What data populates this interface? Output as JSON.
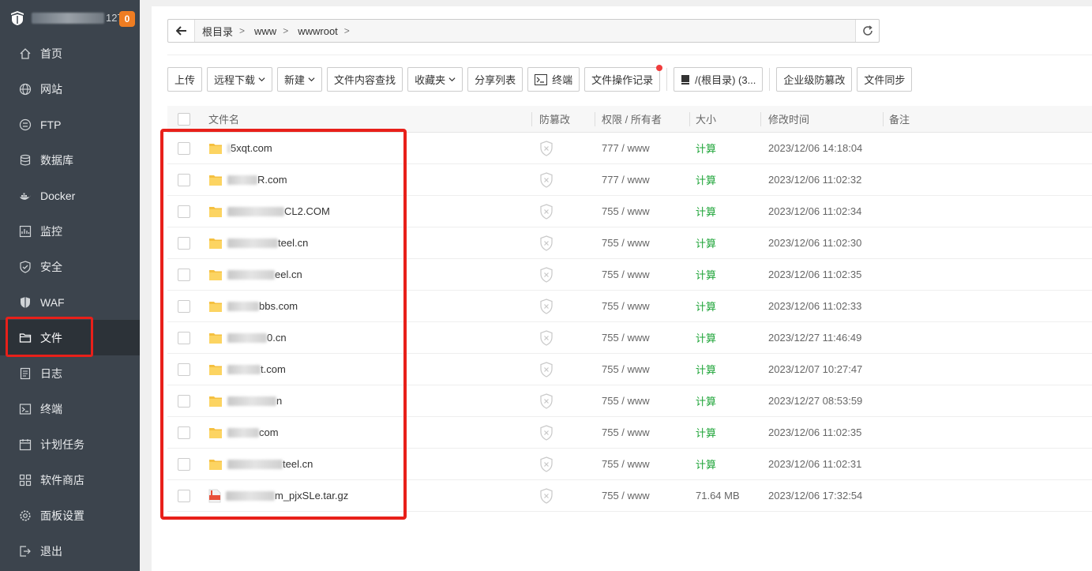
{
  "sidebar": {
    "server_ip_tail": "127",
    "badge_count": "0",
    "items": [
      {
        "label": "首页",
        "icon": "home-icon"
      },
      {
        "label": "网站",
        "icon": "globe-icon"
      },
      {
        "label": "FTP",
        "icon": "ftp-icon"
      },
      {
        "label": "数据库",
        "icon": "database-icon"
      },
      {
        "label": "Docker",
        "icon": "docker-icon"
      },
      {
        "label": "监控",
        "icon": "monitor-icon"
      },
      {
        "label": "安全",
        "icon": "shield-icon"
      },
      {
        "label": "WAF",
        "icon": "waf-shield-icon"
      },
      {
        "label": "文件",
        "icon": "folder-icon",
        "active": true
      },
      {
        "label": "日志",
        "icon": "log-icon"
      },
      {
        "label": "终端",
        "icon": "terminal-icon"
      },
      {
        "label": "计划任务",
        "icon": "calendar-icon"
      },
      {
        "label": "软件商店",
        "icon": "apps-icon"
      },
      {
        "label": "面板设置",
        "icon": "gear-icon"
      },
      {
        "label": "退出",
        "icon": "logout-icon"
      }
    ]
  },
  "pathbar": {
    "crumbs": [
      "根目录",
      "www",
      "wwwroot"
    ]
  },
  "toolbar": {
    "upload": "上传",
    "remote_download": "远程下载",
    "new": "新建",
    "content_search": "文件内容查找",
    "favorites": "收藏夹",
    "share_list": "分享列表",
    "terminal": "终端",
    "operation_log": "文件操作记录",
    "disk": "/(根目录) (3...",
    "enterprise_tamper": "企业级防篡改",
    "file_sync": "文件同步"
  },
  "table": {
    "headers": {
      "name": "文件名",
      "protect": "防篡改",
      "perm": "权限 / 所有者",
      "size": "大小",
      "mtime": "修改时间",
      "note": "备注"
    },
    "rows": [
      {
        "type": "folder",
        "name_visible": "5xqt.com",
        "perm": "777 / www",
        "size": "计算",
        "mtime": "2023/12/06 14:18:04"
      },
      {
        "type": "folder",
        "name_visible": "R.com",
        "perm": "777 / www",
        "size": "计算",
        "mtime": "2023/12/06 11:02:32"
      },
      {
        "type": "folder",
        "name_visible": "CL2.COM",
        "perm": "755 / www",
        "size": "计算",
        "mtime": "2023/12/06 11:02:34"
      },
      {
        "type": "folder",
        "name_visible": "teel.cn",
        "perm": "755 / www",
        "size": "计算",
        "mtime": "2023/12/06 11:02:30"
      },
      {
        "type": "folder",
        "name_visible": "eel.cn",
        "perm": "755 / www",
        "size": "计算",
        "mtime": "2023/12/06 11:02:35"
      },
      {
        "type": "folder",
        "name_visible": "bbs.com",
        "perm": "755 / www",
        "size": "计算",
        "mtime": "2023/12/06 11:02:33"
      },
      {
        "type": "folder",
        "name_visible": "0.cn",
        "perm": "755 / www",
        "size": "计算",
        "mtime": "2023/12/27 11:46:49"
      },
      {
        "type": "folder",
        "name_visible": "t.com",
        "perm": "755 / www",
        "size": "计算",
        "mtime": "2023/12/07 10:27:47"
      },
      {
        "type": "folder",
        "name_visible": "n",
        "perm": "755 / www",
        "size": "计算",
        "mtime": "2023/12/27 08:53:59"
      },
      {
        "type": "folder",
        "name_visible": "com",
        "perm": "755 / www",
        "size": "计算",
        "mtime": "2023/12/06 11:02:35"
      },
      {
        "type": "folder",
        "name_visible": "teel.cn",
        "perm": "755 / www",
        "size": "计算",
        "mtime": "2023/12/06 11:02:31"
      },
      {
        "type": "archive",
        "name_visible": "m_pjxSLe.tar.gz",
        "perm": "755 / www",
        "size": "71.64 MB",
        "mtime": "2023/12/06 17:32:54"
      }
    ]
  },
  "colors": {
    "sidebar_bg": "#3c444d",
    "accent_green": "#20a53a",
    "badge_orange": "#ef7d22",
    "highlight_red": "#e8201a"
  }
}
